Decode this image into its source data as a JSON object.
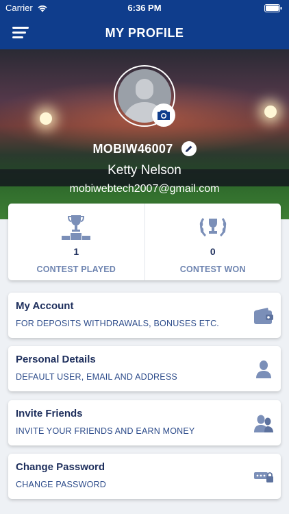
{
  "status_bar": {
    "carrier": "Carrier",
    "time": "6:36 PM"
  },
  "header": {
    "title": "MY PROFILE"
  },
  "profile": {
    "username": "MOBIW46007",
    "name": "Ketty Nelson",
    "email": "mobiwebtech2007@gmail.com"
  },
  "stats": [
    {
      "value": "1",
      "label": "CONTEST PLAYED",
      "icon": "podium-trophy-icon"
    },
    {
      "value": "0",
      "label": "CONTEST WON",
      "icon": "laurel-trophy-icon"
    }
  ],
  "menu": [
    {
      "title": "My Account",
      "subtitle": "FOR DEPOSITS WITHDRAWALS, BONUSES ETC.",
      "icon": "wallet-icon"
    },
    {
      "title": "Personal Details",
      "subtitle": "DEFAULT USER, EMAIL AND ADDRESS",
      "icon": "user-icon"
    },
    {
      "title": "Invite Friends",
      "subtitle": "INVITE YOUR FRIENDS AND EARN MONEY",
      "icon": "users-icon"
    },
    {
      "title": "Change Password",
      "subtitle": "CHANGE PASSWORD",
      "icon": "password-lock-icon"
    }
  ],
  "colors": {
    "primary": "#0f3d8c",
    "title_text": "#1d2e5c",
    "icon": "#7b8fb8"
  }
}
